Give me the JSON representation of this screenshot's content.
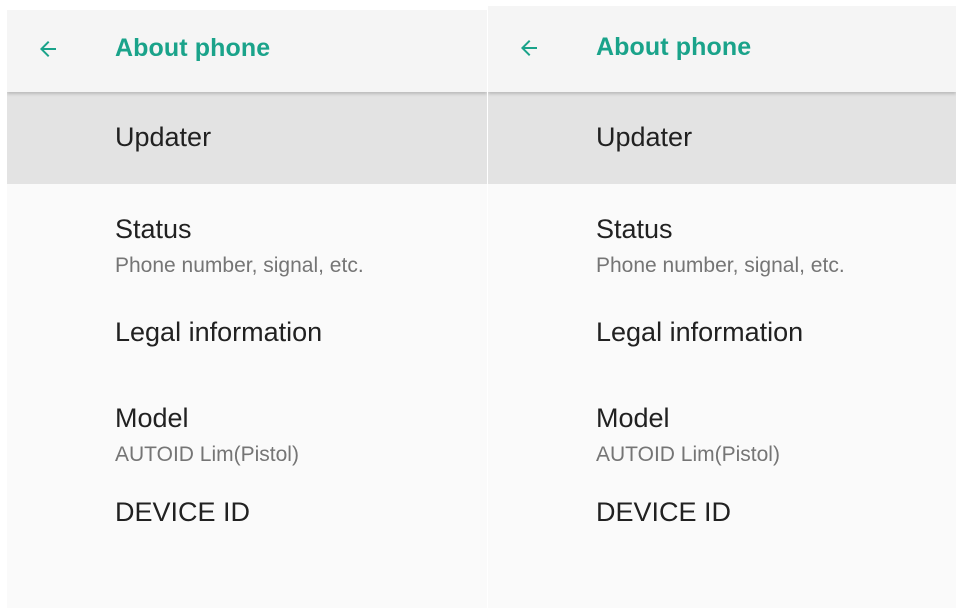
{
  "colors": {
    "accent": "#1aa38a",
    "primary_text": "#212121",
    "secondary_text": "#757575",
    "highlight_row": "#e3e3e3",
    "appbar_bg": "#f5f5f5",
    "page_bg": "#fafafa"
  },
  "screens": [
    {
      "appbar": {
        "back_icon": "arrow-back-icon",
        "title": "About phone"
      },
      "items": [
        {
          "primary": "Updater"
        },
        {
          "primary": "Status",
          "secondary": "Phone number, signal, etc."
        },
        {
          "primary": "Legal information"
        },
        {
          "primary": "Model",
          "secondary": "AUTOID Lim(Pistol)"
        },
        {
          "primary": "DEVICE ID"
        }
      ]
    },
    {
      "appbar": {
        "back_icon": "arrow-back-icon",
        "title": "About phone"
      },
      "items": [
        {
          "primary": "Updater"
        },
        {
          "primary": "Status",
          "secondary": "Phone number, signal, etc."
        },
        {
          "primary": "Legal information"
        },
        {
          "primary": "Model",
          "secondary": "AUTOID Lim(Pistol)"
        },
        {
          "primary": "DEVICE ID"
        }
      ]
    }
  ]
}
